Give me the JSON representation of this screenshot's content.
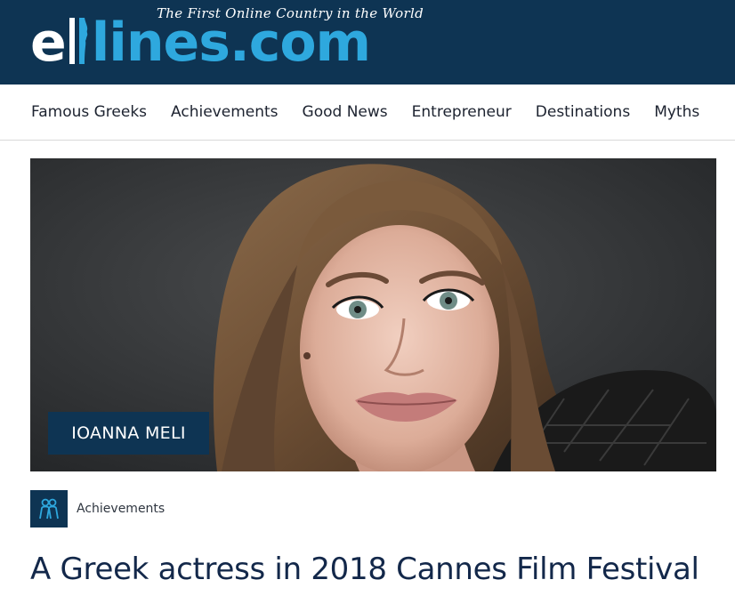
{
  "header": {
    "logo_prefix": "e",
    "logo_suffix": "lines.com",
    "tagline": "The First Online Country in the World",
    "background_color": "#0e3453",
    "accent_color": "#2ea8de"
  },
  "nav": {
    "items": [
      {
        "label": "Famous Greeks"
      },
      {
        "label": "Achievements"
      },
      {
        "label": "Good News"
      },
      {
        "label": "Entrepreneur"
      },
      {
        "label": "Destinations"
      },
      {
        "label": "Myths"
      }
    ]
  },
  "hero": {
    "caption": "IOANNA MELI"
  },
  "article": {
    "category_icon": "people-icon",
    "category": "Achievements",
    "title": "A Greek actress in 2018 Cannes Film Festival"
  }
}
